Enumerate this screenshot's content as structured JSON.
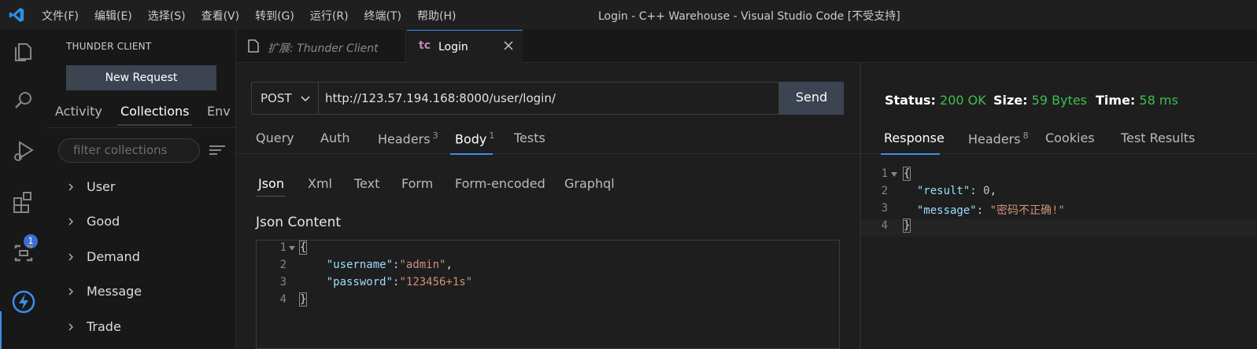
{
  "titlebar": {
    "menu": [
      "文件(F)",
      "编辑(E)",
      "选择(S)",
      "查看(V)",
      "转到(G)",
      "运行(R)",
      "终端(T)",
      "帮助(H)"
    ],
    "window_title": "Login - C++ Warehouse - Visual Studio Code [不受支持]"
  },
  "activitybar": {
    "icons": [
      "explorer-icon",
      "search-icon",
      "run-debug-icon",
      "extensions-icon",
      "remote-icon",
      "thunder-client-icon"
    ],
    "extensions_badge": "1",
    "accent_color": "#3b8eea"
  },
  "sidebar": {
    "title": "THUNDER CLIENT",
    "new_request": "New Request",
    "tabs": [
      "Activity",
      "Collections",
      "Env"
    ],
    "active_tab": "Collections",
    "filter_placeholder": "filter collections",
    "collections": [
      "User",
      "Good",
      "Demand",
      "Message",
      "Trade"
    ]
  },
  "editor_tabs": {
    "tab1": "扩展: Thunder Client",
    "tab2_badge": "tc",
    "tab2": "Login"
  },
  "request": {
    "method": "POST",
    "url": "http://123.57.194.168:8000/user/login/",
    "send": "Send",
    "tabs": {
      "query": "Query",
      "auth": "Auth",
      "headers": "Headers",
      "headers_count": "3",
      "body": "Body",
      "body_count": "1",
      "tests": "Tests"
    },
    "body_tabs": [
      "Json",
      "Xml",
      "Text",
      "Form",
      "Form-encoded",
      "Graphql"
    ],
    "json_title": "Json Content",
    "json_lines": {
      "open": "{",
      "k1": "\"username\"",
      "v1": "\"admin\"",
      "k2": "\"password\"",
      "v2": "\"123456+1s\"",
      "close": "}"
    }
  },
  "response": {
    "status_label": "Status:",
    "status_value": "200 OK",
    "size_label": "Size:",
    "size_value": "59 Bytes",
    "time_label": "Time:",
    "time_value": "58 ms",
    "ok_color": "#3fbf4f",
    "tabs": {
      "response": "Response",
      "headers": "Headers",
      "headers_count": "8",
      "cookies": "Cookies",
      "tests": "Test Results"
    },
    "json_lines": {
      "open": "{",
      "k1": "\"result\"",
      "v1": "0",
      "k2": "\"message\"",
      "v2": "\"密码不正确!\"",
      "close": "}"
    }
  },
  "line_numbers": [
    "1",
    "2",
    "3",
    "4"
  ]
}
